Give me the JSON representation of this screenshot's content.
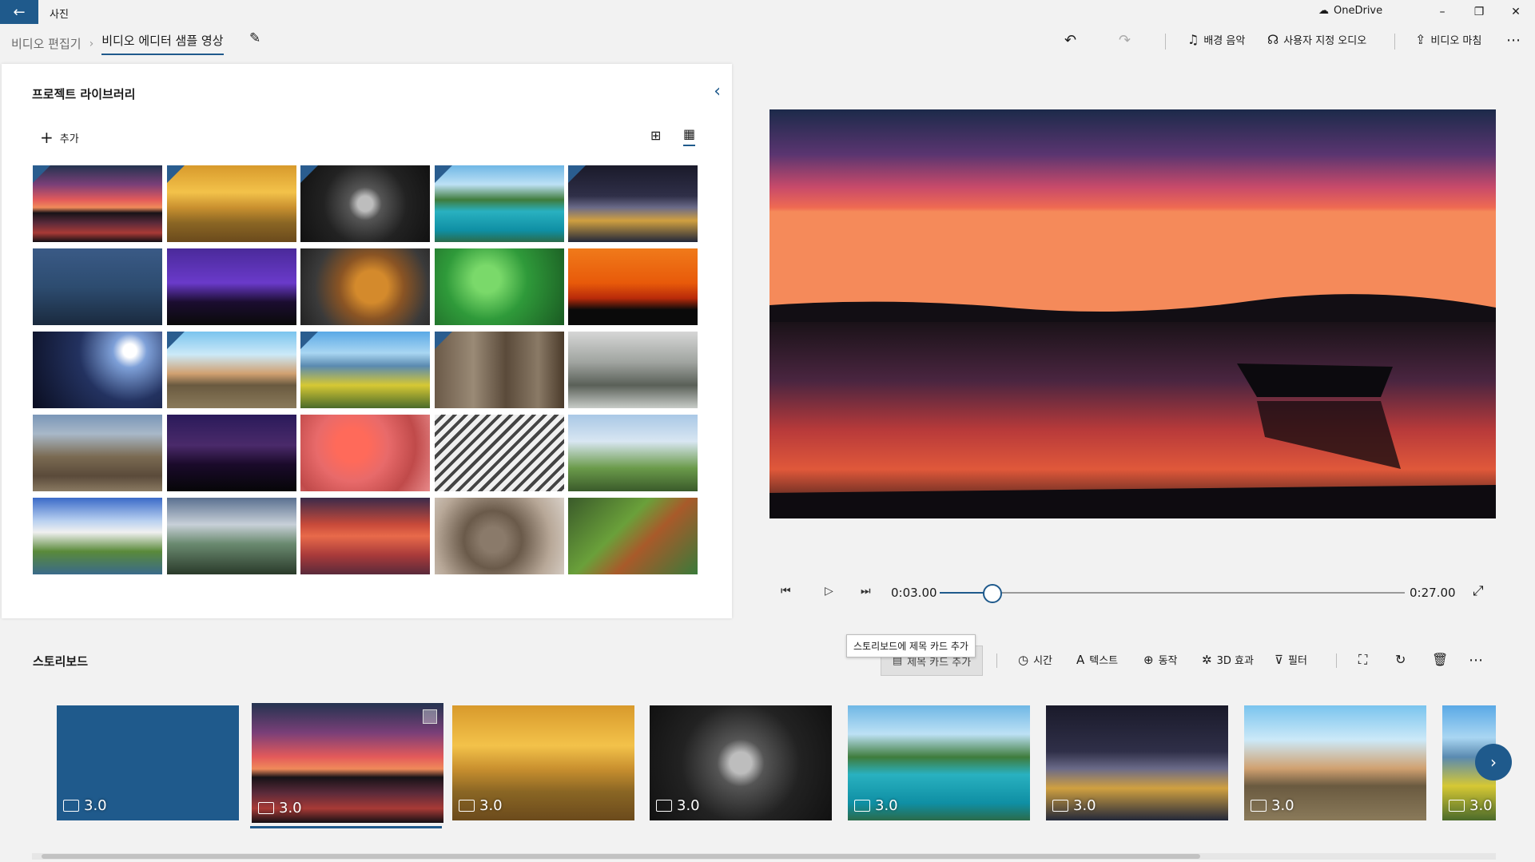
{
  "titlebar": {
    "app_title": "사진",
    "onedrive_label": "OneDrive",
    "minimize": "–",
    "maximize": "❐",
    "close": "✕"
  },
  "commandbar": {
    "breadcrumb_root": "비디오 편집기",
    "breadcrumb_current": "비디오 에디터 샘플 영상",
    "background_music": "배경 음악",
    "custom_audio": "사용자 지정 오디오",
    "finish_video": "비디오 마침",
    "more": "⋯"
  },
  "library": {
    "title": "프로젝트 라이브러리",
    "add_label": "추가",
    "tiles": [
      {
        "scene": "sunset",
        "used": true
      },
      {
        "scene": "golden",
        "used": true
      },
      {
        "scene": "skull",
        "used": true
      },
      {
        "scene": "lake",
        "used": true
      },
      {
        "scene": "milky",
        "used": true
      },
      {
        "scene": "lantern",
        "used": false
      },
      {
        "scene": "purple",
        "used": false
      },
      {
        "scene": "tiger",
        "used": false
      },
      {
        "scene": "drops",
        "used": false
      },
      {
        "scene": "orange",
        "used": false
      },
      {
        "scene": "planet",
        "used": false
      },
      {
        "scene": "venice",
        "used": true
      },
      {
        "scene": "coast",
        "used": true
      },
      {
        "scene": "door",
        "used": true
      },
      {
        "scene": "fog",
        "used": false
      },
      {
        "scene": "valley",
        "used": false
      },
      {
        "scene": "startrl",
        "used": false
      },
      {
        "scene": "poppy",
        "used": false
      },
      {
        "scene": "steel",
        "used": false
      },
      {
        "scene": "eagle",
        "used": false
      },
      {
        "scene": "alps",
        "used": false
      },
      {
        "scene": "train",
        "used": false
      },
      {
        "scene": "redsea",
        "used": false
      },
      {
        "scene": "squirrel",
        "used": false
      },
      {
        "scene": "leaf",
        "used": false
      }
    ]
  },
  "player": {
    "current_time": "0:03.00",
    "end_time": "0:27.00",
    "progress": 0.11
  },
  "storyboard": {
    "title": "스토리보드",
    "tooltip": "스토리보드에 제목 카드 추가",
    "title_card_label": "제목 카드 추가",
    "duration_label": "시간",
    "text_label": "텍스트",
    "motion_label": "동작",
    "effects_label": "3D 효과",
    "filter_label": "필터",
    "cards": [
      {
        "scene": "bluecard",
        "duration": "3.0"
      },
      {
        "scene": "sunset",
        "duration": "3.0"
      },
      {
        "scene": "golden",
        "duration": "3.0"
      },
      {
        "scene": "skull",
        "duration": "3.0"
      },
      {
        "scene": "lake",
        "duration": "3.0"
      },
      {
        "scene": "milky",
        "duration": "3.0"
      },
      {
        "scene": "venice",
        "duration": "3.0"
      },
      {
        "scene": "coast",
        "duration": "3.0"
      }
    ]
  },
  "colors": {
    "accent": "#1f5a8c",
    "background": "#f2f2f2",
    "panel": "#ffffff"
  },
  "icons": {
    "back": "arrow-left-icon",
    "music": "music-note-icon",
    "audio": "person-voice-icon",
    "share": "share-icon",
    "undo": "undo-icon",
    "redo": "redo-icon"
  }
}
